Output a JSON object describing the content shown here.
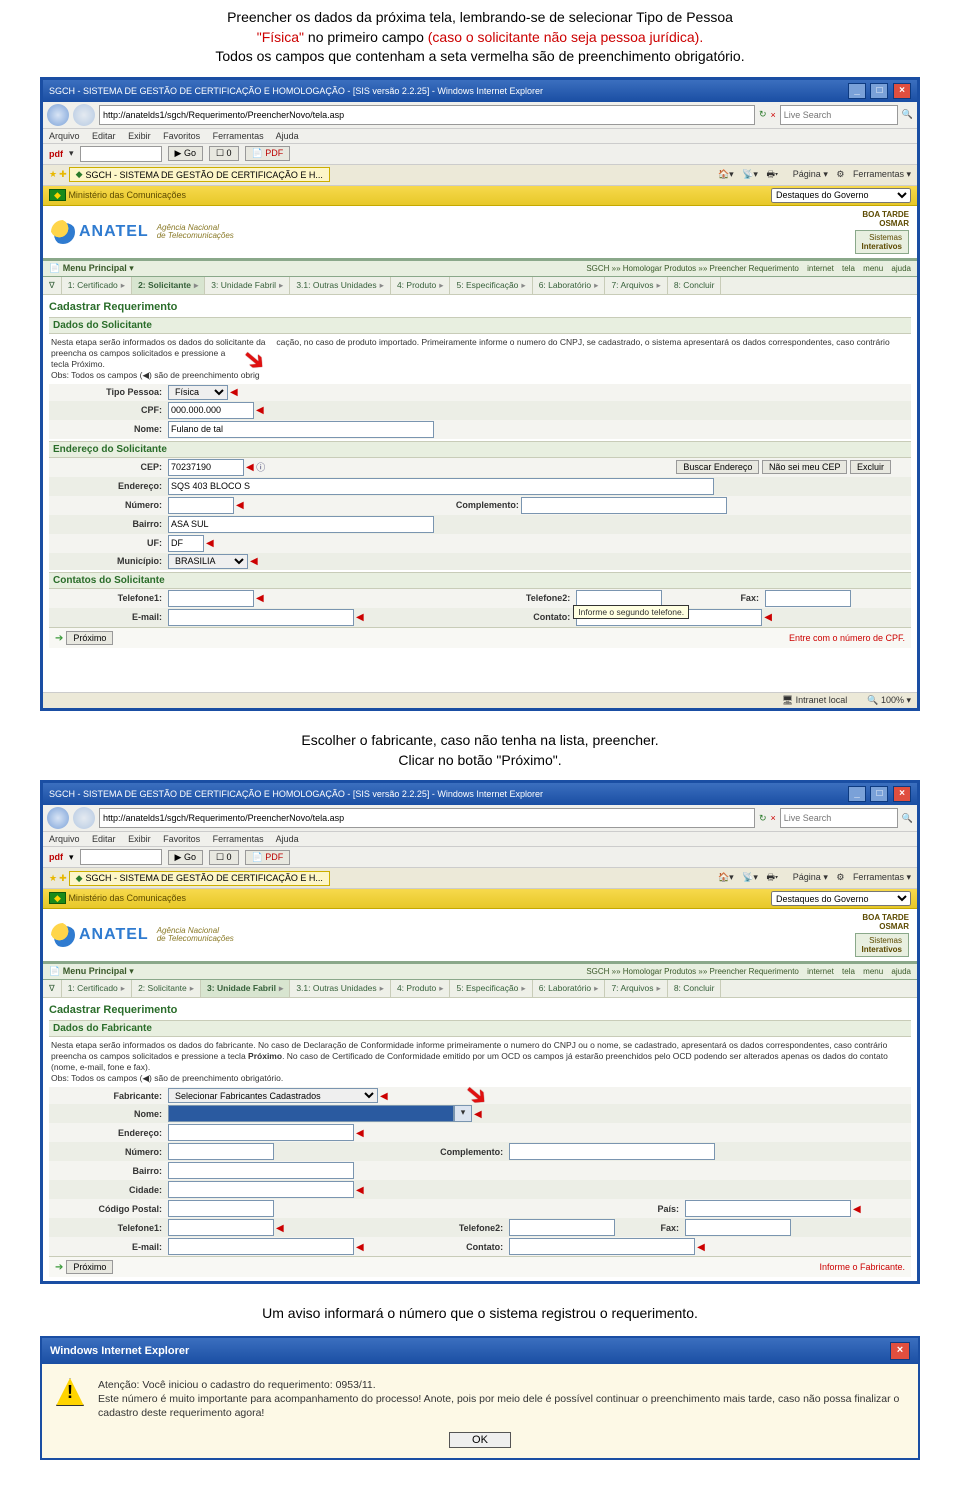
{
  "intro": {
    "line1a": "Preencher os dados da próxima tela, lembrando-se de selecionar Tipo de Pessoa",
    "line2_quoted": "\"Física\"",
    "line2_mid": " no primeiro campo ",
    "line2_red": "(caso o solicitante não seja pessoa jurídica).",
    "line3": "Todos os campos que contenham a seta vermelha são de preenchimento obrigatório."
  },
  "caption2": {
    "line1": "Escolher o fabricante, caso não tenha na lista, preencher.",
    "line2": "Clicar no botão \"Próximo\"."
  },
  "caption3": "Um aviso informará o número que o sistema registrou o requerimento.",
  "browser": {
    "title": "SGCH - SISTEMA DE GESTÃO DE CERTIFICAÇÃO E HOMOLOGAÇÃO - [SIS versão 2.2.25] - Windows Internet Explorer",
    "url": "http://anatelds1/sgch/Requerimento/PreencherNovo/tela.asp",
    "search_placeholder": "Live Search",
    "menus": [
      "Arquivo",
      "Editar",
      "Exibir",
      "Favoritos",
      "Ferramentas",
      "Ajuda"
    ],
    "pdf_label": "pdf",
    "pdf_buttons": [
      "Go",
      "0",
      "PDF"
    ],
    "tab_title": "SGCH - SISTEMA DE GESTÃO DE CERTIFICAÇÃO E H...",
    "ie_tools": [
      "Página",
      "Ferramentas"
    ],
    "ministerio": "Ministério das Comunicações",
    "destaques": "Destaques do Governo",
    "anatel": {
      "name": "ANATEL",
      "sub1": "Agência Nacional",
      "sub2": "de Telecomunicações"
    },
    "greeting1": "BOA TARDE",
    "greeting2": "OSMAR",
    "sistemas": "Sistemas",
    "interativos": "Interativos",
    "menu_principal": "Menu Principal",
    "breadcrumb": "SGCH »» Homologar Produtos »» Preencher Requerimento",
    "right_links": [
      "internet",
      "tela",
      "menu",
      "ajuda"
    ],
    "workflow": [
      {
        "n": "∇",
        "label": ""
      },
      {
        "n": "1:",
        "label": "Certificado"
      },
      {
        "n": "2:",
        "label": "Solicitante"
      },
      {
        "n": "3:",
        "label": "Unidade Fabril"
      },
      {
        "n": "3.1:",
        "label": "Outras Unidades"
      },
      {
        "n": "4:",
        "label": "Produto"
      },
      {
        "n": "5:",
        "label": "Especificação"
      },
      {
        "n": "6:",
        "label": "Laboratório"
      },
      {
        "n": "7:",
        "label": "Arquivos"
      },
      {
        "n": "8:",
        "label": "Concluir"
      }
    ],
    "status_intranet": "Intranet local",
    "status_zoom": "100%"
  },
  "form1": {
    "page_title": "Cadastrar Requerimento",
    "section_dados": "Dados do Solicitante",
    "help1": "Nesta etapa serão informados os dados do solicitante da",
    "help1b": "cação, no caso de produto importado. Primeiramente informe o numero do CNPJ, se cadastrado, o sistema apresentará os dados correspondentes, caso contrário preencha os campos solicitados e pressione a",
    "help_tecla": "tecla Próximo.",
    "help_obs": "Obs: Todos os campos (◀) são de preenchimento obrig",
    "lbl_tipo": "Tipo Pessoa:",
    "val_tipo": "Física",
    "lbl_cpf": "CPF:",
    "val_cpf": "000.000.000",
    "lbl_nome": "Nome:",
    "val_nome": "Fulano de tal",
    "section_endereco": "Endereço do Solicitante",
    "lbl_cep": "CEP:",
    "val_cep": "70237190",
    "btn_buscar": "Buscar Endereço",
    "btn_naosei": "Não sei meu CEP",
    "btn_excluir": "Excluir",
    "lbl_endereco": "Endereço:",
    "val_endereco": "SQS 403 BLOCO S",
    "lbl_numero": "Número:",
    "lbl_complemento": "Complemento:",
    "lbl_bairro": "Bairro:",
    "val_bairro": "ASA SUL",
    "lbl_uf": "UF:",
    "val_uf": "DF",
    "lbl_municipio": "Município:",
    "val_municipio": "BRASILIA",
    "section_contatos": "Contatos do Solicitante",
    "lbl_tel1": "Telefone1:",
    "lbl_tel2": "Telefone2:",
    "lbl_fax": "Fax:",
    "lbl_email": "E-mail:",
    "lbl_contato": "Contato:",
    "tooltip_tel2": "Informe o segundo telefone.",
    "btn_proximo": "Próximo",
    "footer_msg": "Entre com o número de CPF."
  },
  "form2": {
    "page_title": "Cadastrar Requerimento",
    "section_dados": "Dados do Fabricante",
    "help": "Nesta etapa serão informados os dados do fabricante. No caso de Declaração de Conformidade informe primeiramente o numero do CNPJ ou o nome, se cadastrado, apresentará os dados correspondentes, caso contrário preencha os campos solicitados e pressione a tecla",
    "help_b": "Próximo",
    "help_c": ". No caso de Certificado de Conformidade emitido por um OCD os campos já estarão preenchidos pelo OCD podendo ser alterados apenas os dados do contato (nome, e-mail, fone e fax).",
    "help_obs": "Obs: Todos os campos (◀) são de preenchimento obrigatório.",
    "lbl_fabricante": "Fabricante:",
    "val_fabricante": "Selecionar Fabricantes Cadastrados",
    "lbl_nome": "Nome:",
    "lbl_endereco": "Endereço:",
    "lbl_numero": "Número:",
    "lbl_complemento": "Complemento:",
    "lbl_bairro": "Bairro:",
    "lbl_cidade": "Cidade:",
    "lbl_codpostal": "Código Postal:",
    "lbl_pais": "País:",
    "lbl_tel1": "Telefone1:",
    "lbl_tel2": "Telefone2:",
    "lbl_fax": "Fax:",
    "lbl_email": "E-mail:",
    "lbl_contato": "Contato:",
    "btn_proximo": "Próximo",
    "footer_msg": "Informe o Fabricante."
  },
  "alert": {
    "title": "Windows Internet Explorer",
    "line1": "Atenção: Você iniciou o cadastro do requerimento: 0953/11.",
    "line2": "Este número é muito importante para acompanhamento do processo! Anote, pois por meio dele é possível continuar o preenchimento mais tarde, caso não possa finalizar o cadastro deste requerimento agora!",
    "ok": "OK"
  }
}
